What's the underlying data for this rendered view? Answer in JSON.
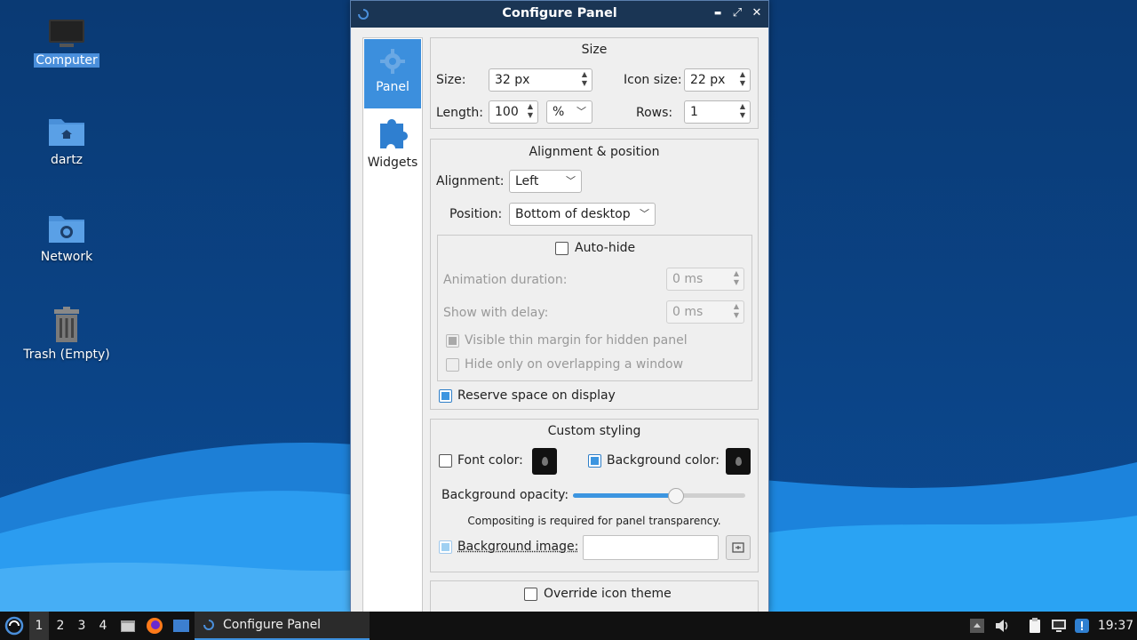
{
  "desktop": {
    "icons": [
      {
        "label": "Computer",
        "icon": "computer-icon",
        "selected": true
      },
      {
        "label": "dartz",
        "icon": "home-folder-icon"
      },
      {
        "label": "Network",
        "icon": "network-folder-icon"
      },
      {
        "label": "Trash (Empty)",
        "icon": "trash-icon"
      }
    ]
  },
  "window": {
    "title": "Configure Panel",
    "controls": {
      "minimize": "▬",
      "maximize": "⤢",
      "close": "✕"
    },
    "sidebar": {
      "items": [
        {
          "label": "Panel",
          "icon": "gear-icon",
          "active": true
        },
        {
          "label": "Widgets",
          "icon": "puzzle-icon"
        }
      ]
    },
    "size_group": {
      "title": "Size",
      "size_label": "Size:",
      "size_value": "32 px",
      "icon_size_label": "Icon size:",
      "icon_size_value": "22 px",
      "length_label": "Length:",
      "length_value": "100",
      "length_unit": "%",
      "rows_label": "Rows:",
      "rows_value": "1"
    },
    "alignment_group": {
      "title": "Alignment & position",
      "alignment_label": "Alignment:",
      "alignment_value": "Left",
      "position_label": "Position:",
      "position_value": "Bottom of desktop",
      "autohide_label": "Auto-hide",
      "autohide_checked": false,
      "animation_label": "Animation duration:",
      "animation_value": "0 ms",
      "delay_label": "Show with delay:",
      "delay_value": "0 ms",
      "thin_margin_label": "Visible thin margin for hidden panel",
      "thin_margin_checked": true,
      "overlap_label": "Hide only on overlapping a window",
      "overlap_checked": false,
      "reserve_label": "Reserve space on display",
      "reserve_checked": true
    },
    "styling_group": {
      "title": "Custom styling",
      "font_color_label": "Font color:",
      "font_color_checked": false,
      "bg_color_label": "Background color:",
      "bg_color_checked": true,
      "opacity_label": "Background opacity:",
      "opacity_fraction": 0.6,
      "compositing_note": "Compositing is required for panel transparency.",
      "bg_image_label": "Background image:",
      "bg_image_value": ""
    },
    "override_group": {
      "label": "Override icon theme",
      "checked": false
    }
  },
  "taskbar": {
    "workspaces": [
      "1",
      "2",
      "3",
      "4"
    ],
    "active_workspace": "1",
    "task_label": "Configure Panel",
    "clock": "19:37",
    "accent": "#3c8fdd"
  }
}
